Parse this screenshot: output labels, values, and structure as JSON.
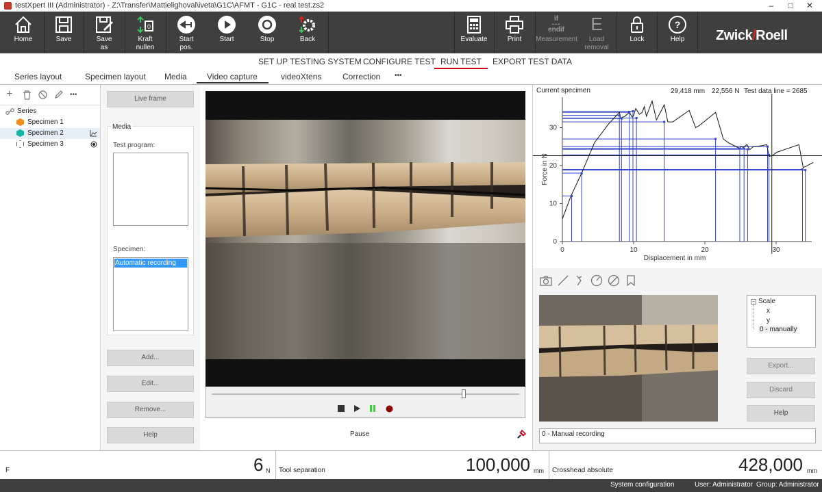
{
  "window": {
    "title": "testXpert III (Administrator) - Z:\\Transfer\\Mattielighoval\\iveta\\G1C\\AFMT - G1C - real test.zs2"
  },
  "toolbar": {
    "home": "Home",
    "save": "Save",
    "save_as": "Save\nas",
    "kraft": "Kraft\nnullen",
    "start_pos": "Start\npos.",
    "start": "Start",
    "stop": "Stop",
    "back": "Back",
    "evaluate": "Evaluate",
    "print": "Print",
    "measurement": "Measurement",
    "measurement_icon_top": "if",
    "measurement_icon_bottom": "endif",
    "load_removal": "Load\nremoval",
    "load_icon": "E",
    "lock": "Lock",
    "help": "Help",
    "logo_left": "Zwick",
    "logo_slash": "/",
    "logo_right": "Roell"
  },
  "main_nav": [
    "SET UP TESTING SYSTEM",
    "CONFIGURE TEST",
    "RUN TEST",
    "EXPORT TEST DATA"
  ],
  "sub_tabs": [
    "Series layout",
    "Specimen layout",
    "Media",
    "Video capture",
    "videoXtens",
    "Correction",
    "•••"
  ],
  "tree": {
    "toolbar_more": "•••",
    "root": "Series",
    "specimens": [
      "Specimen 1",
      "Specimen 2",
      "Specimen 3"
    ]
  },
  "media": {
    "live_frame": "Live frame",
    "group_title": "Media",
    "test_program_label": "Test program:",
    "specimen_label": "Specimen:",
    "specimen_selected": "Automatic recording",
    "add": "Add...",
    "edit": "Edit...",
    "remove": "Remove...",
    "help": "Help"
  },
  "video": {
    "status": "Pause",
    "slider_position": 0.82
  },
  "chart_header": {
    "title": "Current specimen",
    "displacement": "29,418 mm",
    "force": "22,556 N",
    "data_line": "Test data line = 2685"
  },
  "chart_data": {
    "type": "line",
    "xlabel": "Displacement in mm",
    "ylabel": "Force in N",
    "xlim": [
      0,
      35
    ],
    "ylim": [
      0,
      38
    ],
    "xticks": [
      0,
      10,
      20,
      30
    ],
    "yticks": [
      0,
      10,
      20,
      30
    ],
    "cursor": {
      "x": 29.4,
      "y": 22.6
    },
    "series": [
      {
        "x": [
          0,
          1.2,
          2.7,
          4.5,
          6.5,
          8.0,
          8.2,
          8.8,
          9.4,
          9.8,
          10.0,
          10.3,
          10.8,
          11.2,
          11.5,
          11.8,
          12.6,
          13.2,
          14.3,
          14.8,
          15.5,
          17.8,
          18.7,
          19.2,
          21.5,
          22.6,
          23.3,
          24.9,
          25.0,
          25.4,
          25.9,
          26.3,
          26.8,
          27.2,
          28.7,
          29.0,
          29.4,
          29.6,
          30.1,
          33.2,
          33.8,
          34.2,
          34.8,
          35.2
        ],
        "y": [
          6,
          12,
          18,
          26,
          31,
          34,
          32.5,
          33,
          34,
          32.8,
          33.2,
          35,
          33.5,
          34,
          35.5,
          33,
          37,
          32,
          36,
          31.5,
          31.5,
          34.5,
          30,
          30.5,
          34,
          27,
          26,
          24.5,
          25.0,
          24.8,
          25.5,
          24.2,
          25.0,
          25.0,
          25.5,
          22.4,
          22.6,
          22.8,
          23.5,
          25.5,
          19.5,
          19.8,
          20.4,
          20.8
        ]
      }
    ],
    "markers": [
      {
        "x": 1.3,
        "y": 12
      },
      {
        "x": 2.7,
        "y": 18
      },
      {
        "x": 8.0,
        "y": 33.2
      },
      {
        "x": 8.3,
        "y": 32.4
      },
      {
        "x": 9.4,
        "y": 34.0
      },
      {
        "x": 9.9,
        "y": 34.3
      },
      {
        "x": 10.4,
        "y": 32.5
      },
      {
        "x": 14.3,
        "y": 31.5
      },
      {
        "x": 21.5,
        "y": 27.0
      },
      {
        "x": 24.9,
        "y": 24.5
      },
      {
        "x": 25.5,
        "y": 24.5
      },
      {
        "x": 26.0,
        "y": 24.3
      },
      {
        "x": 28.8,
        "y": 25.0
      },
      {
        "x": 29.0,
        "y": 22.8
      },
      {
        "x": 33.7,
        "y": 19.0
      },
      {
        "x": 34.1,
        "y": 18.8
      }
    ]
  },
  "video_tools": [
    "camera-icon",
    "line-icon",
    "angle-icon",
    "circle-measure-icon",
    "circle-slash-icon",
    "bookmark-icon"
  ],
  "scale_tree": {
    "root": "Scale",
    "children": [
      "x",
      "y",
      "0 - manually"
    ]
  },
  "lower_buttons": {
    "export": "Export...",
    "discard": "Discard",
    "help": "Help"
  },
  "recording_field": "0 - Manual recording",
  "status": {
    "f_label": "F",
    "force_value": "6",
    "force_unit": "N",
    "tool_sep_label": "Tool separation",
    "tool_sep_value": "100,000",
    "tool_sep_unit": "mm",
    "crosshead_label": "Crosshead absolute",
    "crosshead_value": "428,000",
    "crosshead_unit": "mm"
  },
  "bottom_bar": {
    "system_config": "System configuration",
    "user": "User: Administrator",
    "group": "Group: Administrator"
  }
}
